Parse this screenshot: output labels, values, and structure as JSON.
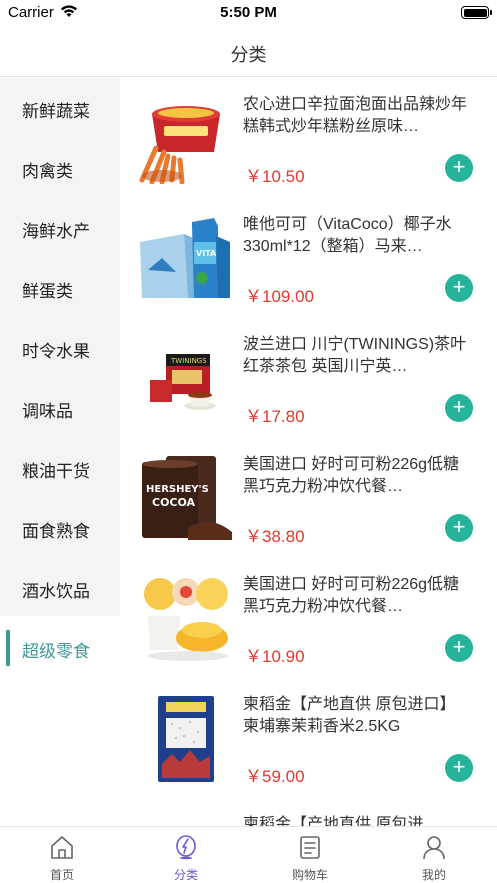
{
  "status_bar": {
    "carrier": "Carrier",
    "time": "5:50 PM"
  },
  "nav": {
    "title": "分类"
  },
  "sidebar": {
    "items": [
      {
        "label": "新鲜蔬菜"
      },
      {
        "label": "肉禽类"
      },
      {
        "label": "海鲜水产"
      },
      {
        "label": "鲜蛋类"
      },
      {
        "label": "时令水果"
      },
      {
        "label": "调味品"
      },
      {
        "label": "粮油干货"
      },
      {
        "label": "面食熟食"
      },
      {
        "label": "酒水饮品"
      },
      {
        "label": "超级零食",
        "active": true
      }
    ]
  },
  "products": [
    {
      "name": "农心进口辛拉面泡面出品辣炒年糕韩式炒年糕粉丝原味…",
      "price": "￥10.50",
      "image": "noodle-cup"
    },
    {
      "name": "唯他可可（VitaCoco）椰子水330ml*12（整箱）马来…",
      "price": "￥109.00",
      "image": "coconut-water"
    },
    {
      "name": "波兰进口 川宁(TWININGS)茶叶红茶茶包 英国川宁英…",
      "price": "￥17.80",
      "image": "tea-box"
    },
    {
      "name": "美国进口 好时可可粉226g低糖黑巧克力粉冲饮代餐…",
      "price": "￥38.80",
      "image": "cocoa-tin"
    },
    {
      "name": "美国进口 好时可可粉226g低糖黑巧克力粉冲饮代餐…",
      "price": "￥10.90",
      "image": "fruit-jelly"
    },
    {
      "name": "柬稻金【产地直供 原包进口】柬埔寨茉莉香米2.5KG",
      "price": "￥59.00",
      "image": "rice-bag"
    },
    {
      "name": "柬稻金【产地直供 原包进",
      "price": "",
      "image": "rice-bag"
    }
  ],
  "tabs": [
    {
      "label": "首页",
      "icon": "home-icon"
    },
    {
      "label": "分类",
      "icon": "category-icon",
      "active": true
    },
    {
      "label": "购物车",
      "icon": "cart-list-icon"
    },
    {
      "label": "我的",
      "icon": "profile-icon"
    }
  ],
  "colors": {
    "accent": "#3f9a97",
    "price": "#e4392c",
    "add_button": "#25b49a",
    "tab_active": "#6a5acd"
  }
}
